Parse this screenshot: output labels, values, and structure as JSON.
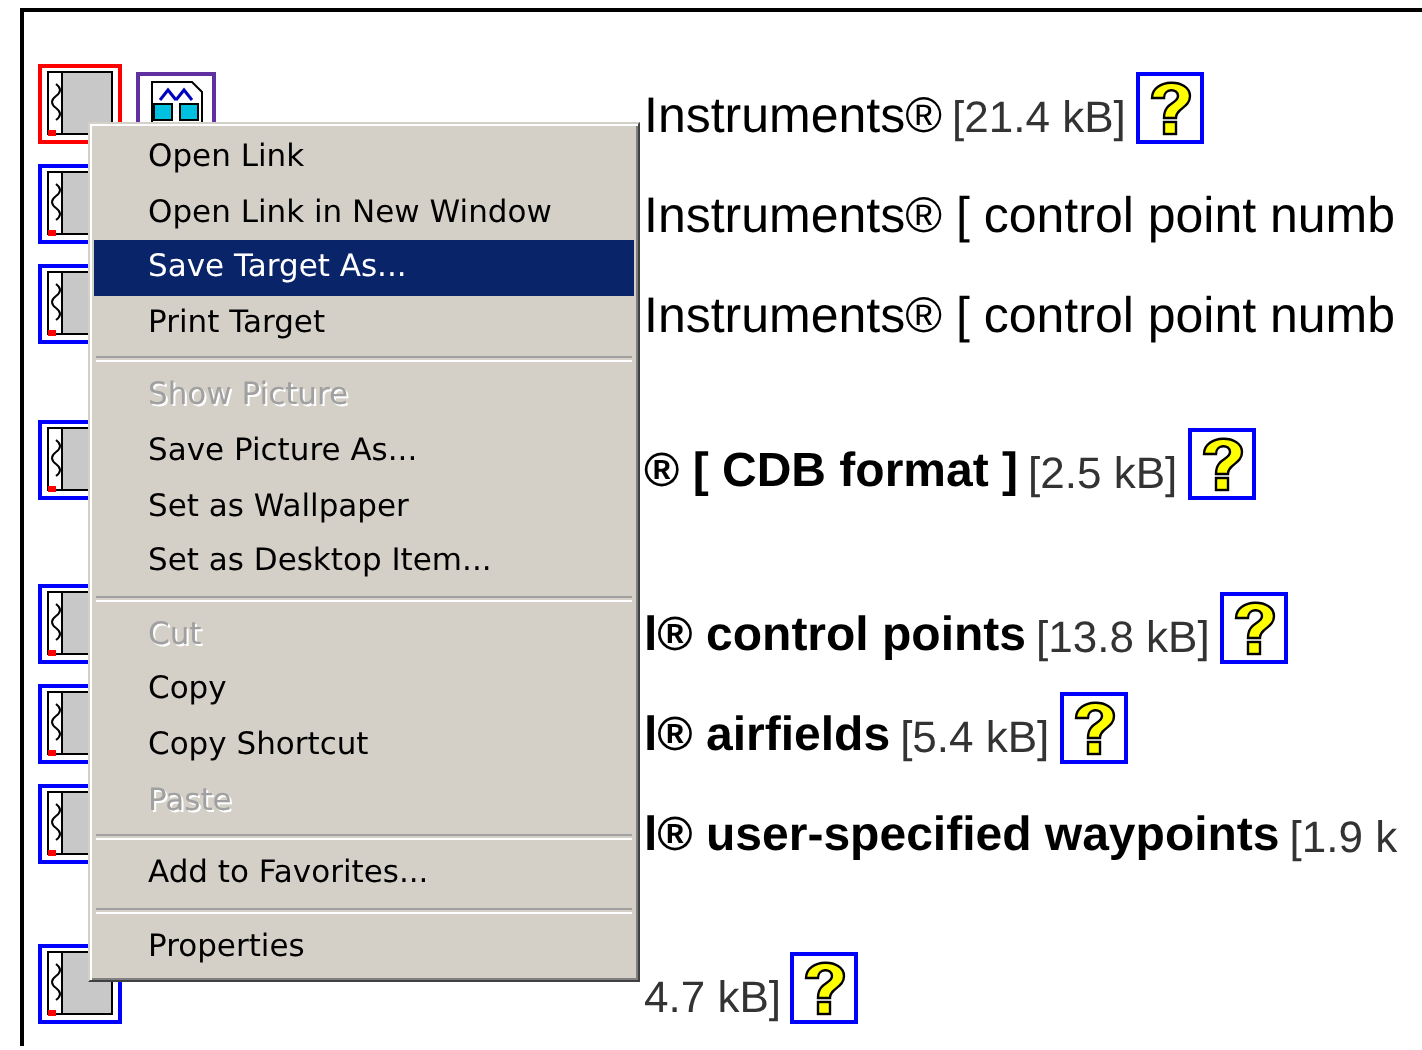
{
  "rows": [
    {
      "focused": true,
      "preview": true,
      "title": "Instruments®",
      "bold": false,
      "size": "[21.4 kB]",
      "help": true
    },
    {
      "focused": false,
      "title": "Instruments® [ control point numb",
      "bold": false
    },
    {
      "focused": false,
      "title": "Instruments® [ control point numb",
      "bold": false
    },
    {
      "focused": false,
      "title": "® [ CDB format ]",
      "bold": true,
      "size": "[2.5 kB]",
      "help": true
    },
    {
      "focused": false,
      "title": "l® control points",
      "bold": true,
      "size": "[13.8 kB]",
      "help": true
    },
    {
      "focused": false,
      "title": "l® airfields",
      "bold": true,
      "size": "[5.4 kB]",
      "help": true
    },
    {
      "focused": false,
      "title": "l® user-specified waypoints",
      "bold": true,
      "size": "[1.9 k"
    },
    {
      "focused": false,
      "size": "4.7 kB]",
      "help": true
    }
  ],
  "context_menu": {
    "items": [
      {
        "kind": "item",
        "label": "Open Link",
        "disabled": false,
        "selected": false
      },
      {
        "kind": "item",
        "label": "Open Link in New Window",
        "disabled": false,
        "selected": false
      },
      {
        "kind": "item",
        "label": "Save Target As...",
        "disabled": false,
        "selected": true
      },
      {
        "kind": "item",
        "label": "Print Target",
        "disabled": false,
        "selected": false
      },
      {
        "kind": "separator"
      },
      {
        "kind": "item",
        "label": "Show Picture",
        "disabled": true,
        "selected": false
      },
      {
        "kind": "item",
        "label": "Save Picture As...",
        "disabled": false,
        "selected": false
      },
      {
        "kind": "item",
        "label": "Set as Wallpaper",
        "disabled": false,
        "selected": false
      },
      {
        "kind": "item",
        "label": "Set as Desktop Item...",
        "disabled": false,
        "selected": false
      },
      {
        "kind": "separator"
      },
      {
        "kind": "item",
        "label": "Cut",
        "disabled": true,
        "selected": false
      },
      {
        "kind": "item",
        "label": "Copy",
        "disabled": false,
        "selected": false
      },
      {
        "kind": "item",
        "label": "Copy Shortcut",
        "disabled": false,
        "selected": false
      },
      {
        "kind": "item",
        "label": "Paste",
        "disabled": true,
        "selected": false
      },
      {
        "kind": "separator"
      },
      {
        "kind": "item",
        "label": "Add to Favorites...",
        "disabled": false,
        "selected": false
      },
      {
        "kind": "separator"
      },
      {
        "kind": "item",
        "label": "Properties",
        "disabled": false,
        "selected": false
      }
    ]
  }
}
